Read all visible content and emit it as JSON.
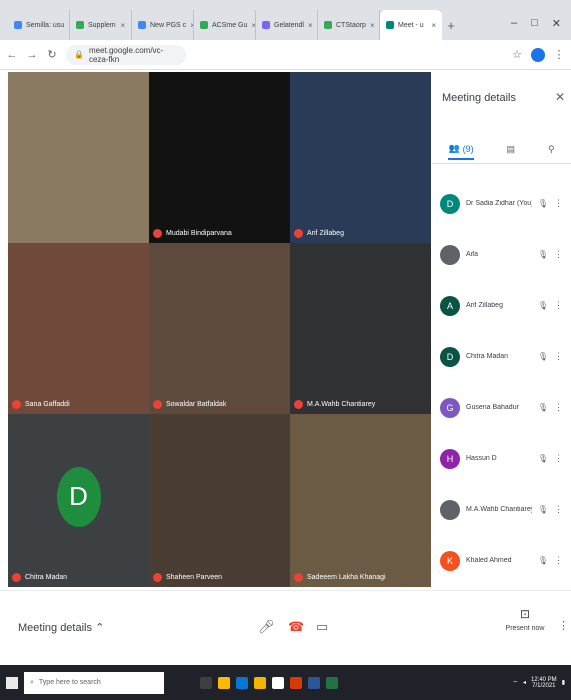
{
  "browser": {
    "tabs": [
      {
        "label": "Semilla: usu",
        "color": "#4285f4"
      },
      {
        "label": "Supplem",
        "color": "#34a853"
      },
      {
        "label": "New PGS c",
        "color": "#4285f4"
      },
      {
        "label": "ACSme Gu",
        "color": "#34a853"
      },
      {
        "label": "Gelatendl",
        "color": "#7b61ff"
      },
      {
        "label": "CTStaorp",
        "color": "#34a853"
      },
      {
        "label": "Meet - u",
        "color": "#00897b"
      }
    ],
    "address": "meet.google.com/vc-ceza-fkn"
  },
  "grid": {
    "tiles": [
      {
        "name": "",
        "bg": "#8a7a62"
      },
      {
        "name": "Mudabi Bindiparvana",
        "bg": "#121212"
      },
      {
        "name": "Arif Zillabeg",
        "bg": "#2a3b57"
      },
      {
        "name": "Sana Gaffaddi",
        "bg": "#6f4a3a"
      },
      {
        "name": "Sowaldar Batfaldak",
        "bg": "#5d4a3c"
      },
      {
        "name": "M.A.Wahb Chantiarey",
        "bg": "#2f3133"
      },
      {
        "name": "Chitra Madan",
        "bg": "#3c4043",
        "avatar": "D",
        "avatar_color": "#1e8e3e"
      },
      {
        "name": "Shaheen Parveen",
        "bg": "#4a3d33"
      },
      {
        "name": "Sadeeem Lakha Khanagi",
        "bg": "#6b5a44"
      }
    ]
  },
  "panel": {
    "title": "Meeting details",
    "tab_people_count": "(9)",
    "participants": [
      {
        "name": "Dr Sadia Zidhar (You)",
        "initial": "D",
        "color": "#00897b"
      },
      {
        "name": "Aifa",
        "initial": "",
        "color": "#5f6368"
      },
      {
        "name": "Arif Zillabeg",
        "initial": "A",
        "color": "#0b5345"
      },
      {
        "name": "Chitra Madan",
        "initial": "D",
        "color": "#0b5345"
      },
      {
        "name": "Gusena Bahadur",
        "initial": "G",
        "color": "#7e57c2"
      },
      {
        "name": "Hassun D",
        "initial": "H",
        "color": "#8e24aa"
      },
      {
        "name": "M.A.Wahb Chantiarey",
        "initial": "",
        "color": "#5f6368"
      },
      {
        "name": "Khaled Ahmed",
        "initial": "K",
        "color": "#f4511e"
      }
    ]
  },
  "bottom_bar": {
    "meeting_details": "Meeting details",
    "present": "Present now"
  },
  "taskbar": {
    "search_placeholder": "Type here to search",
    "time": "12:40 PM",
    "date": "7/1/2021"
  }
}
